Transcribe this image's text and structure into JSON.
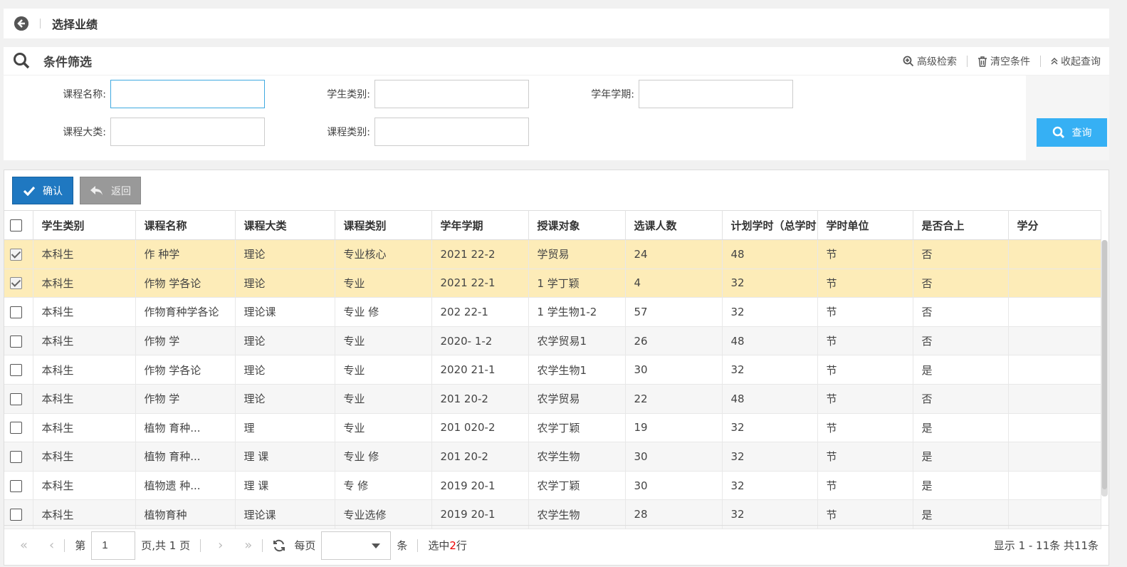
{
  "header": {
    "title": "选择业绩"
  },
  "filter": {
    "title": "条件筛选",
    "actions": {
      "advanced": "高级检索",
      "clear": "清空条件",
      "collapse": "收起查询"
    },
    "fields": [
      {
        "label": "课程名称:",
        "value": ""
      },
      {
        "label": "学生类别:",
        "value": ""
      },
      {
        "label": "学年学期:",
        "value": ""
      },
      {
        "label": "课程大类:",
        "value": ""
      },
      {
        "label": "课程类别:",
        "value": ""
      }
    ],
    "query_label": "查询"
  },
  "toolbar": {
    "confirm_label": "确认",
    "back_label": "返回"
  },
  "table": {
    "columns": [
      "学生类别",
      "课程名称",
      "课程大类",
      "课程类别",
      "学年学期",
      "授课对象",
      "选课人数",
      "计划学时（总学时",
      "学时单位",
      "是否合上",
      "学分"
    ],
    "rows": [
      {
        "checked": true,
        "cells": [
          "本科生",
          "作    种学",
          "理论",
          "专业核心",
          "2021  22-2",
          "  学贸易",
          "24",
          "48",
          "节",
          "否",
          ""
        ]
      },
      {
        "checked": true,
        "cells": [
          "本科生",
          "作物   学各论",
          "理论",
          "专业",
          "2021  22-1",
          "1  学丁颖",
          "4",
          "32",
          "节",
          "否",
          ""
        ]
      },
      {
        "checked": false,
        "cells": [
          "本科生",
          "作物育种学各论",
          "理论课",
          "专业  修",
          "202  22-1",
          "1  学生物1-2",
          "57",
          "32",
          "节",
          "否",
          ""
        ]
      },
      {
        "checked": false,
        "cells": [
          "本科生",
          "作物  学",
          "理论",
          "专业",
          "2020-  1-2",
          "  农学贸易1",
          "26",
          "48",
          "节",
          "否",
          ""
        ]
      },
      {
        "checked": false,
        "cells": [
          "本科生",
          "作物  学各论",
          "理论",
          "专业",
          "2020  21-1",
          "  农学生物1",
          "30",
          "32",
          "节",
          "是",
          ""
        ]
      },
      {
        "checked": false,
        "cells": [
          "本科生",
          "作物  学",
          "理论",
          "专业",
          "201  20-2",
          "  农学贸易",
          "22",
          "48",
          "节",
          "否",
          ""
        ]
      },
      {
        "checked": false,
        "cells": [
          "本科生",
          "植物  育种...",
          "理",
          "专业",
          "201  020-2",
          "  农学丁颖",
          "19",
          "32",
          "节",
          "是",
          ""
        ]
      },
      {
        "checked": false,
        "cells": [
          "本科生",
          "植物  育种...",
          "理  课",
          "专业  修",
          "201  20-2",
          "  农学生物",
          "30",
          "32",
          "节",
          "是",
          ""
        ]
      },
      {
        "checked": false,
        "cells": [
          "本科生",
          "植物遗  种...",
          "理  课",
          "专  修",
          "2019  20-1",
          "  农学丁颖",
          "30",
          "32",
          "节",
          "是",
          ""
        ]
      },
      {
        "checked": false,
        "cells": [
          "本科生",
          "植物育种",
          "理论课",
          "专业选修",
          "2019  20-1",
          "  农学生物",
          "28",
          "32",
          "节",
          "是",
          ""
        ]
      }
    ]
  },
  "pager": {
    "page_prefix": "第",
    "page_value": "1",
    "page_suffix": "页,共 1 页",
    "per_page_prefix": "每页",
    "per_page_suffix": "条",
    "selected_prefix": "选中",
    "selected_count": "2",
    "selected_suffix": "行",
    "summary": "显示 1 - 11条 共11条"
  }
}
